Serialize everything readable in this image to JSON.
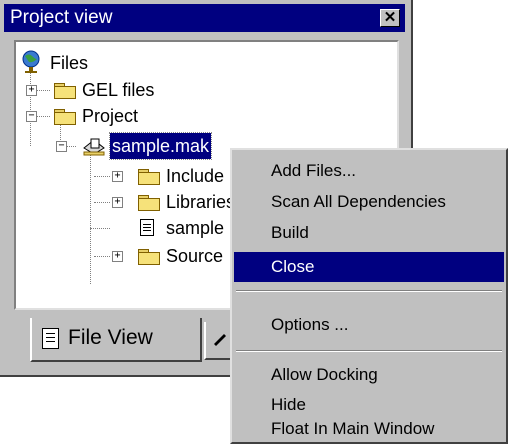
{
  "window": {
    "title": "Project view",
    "close_glyph": "✕"
  },
  "tree": {
    "root": "Files",
    "gel_files": "GEL files",
    "project": "Project",
    "sample": "sample.mak",
    "include": "Include",
    "libraries": "Libraries",
    "sample_file": "sample",
    "source": "Source"
  },
  "tabs": {
    "file_view": "File View"
  },
  "context_menu": {
    "items": [
      {
        "label": "Add Files..."
      },
      {
        "label": "Scan All Dependencies"
      },
      {
        "label": "Build"
      },
      {
        "label": "Close",
        "highlighted": true
      },
      {
        "label": "Options ..."
      },
      {
        "label": "Allow Docking"
      },
      {
        "label": "Hide"
      },
      {
        "label": "Float In Main Window"
      }
    ]
  },
  "colors": {
    "title_bar": "#000080",
    "highlight": "#000080",
    "face": "#c0c0c0",
    "folder": "#f6e27a"
  }
}
